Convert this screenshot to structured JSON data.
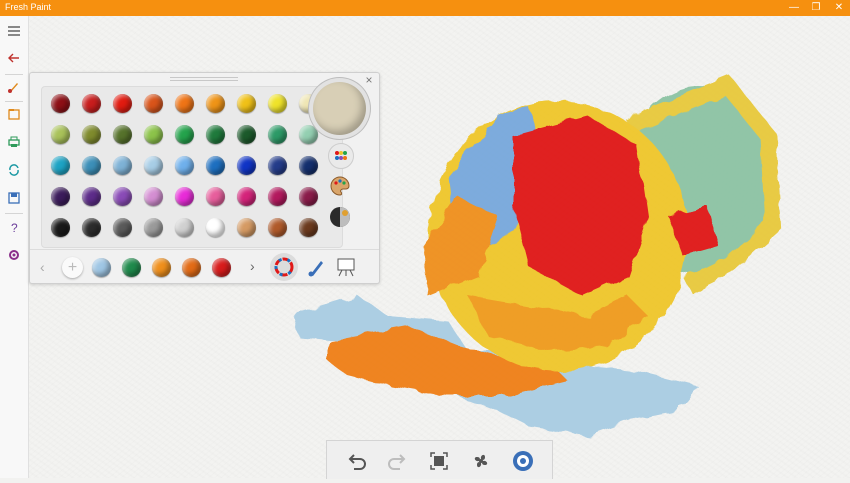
{
  "window": {
    "title": "Fresh Paint",
    "controls": [
      "—",
      "❐",
      "✕"
    ]
  },
  "sidebar": {
    "items": [
      "menu-icon",
      "back-icon",
      "brush-icon",
      "open-icon",
      "print-icon",
      "share-icon",
      "save-icon",
      "help-icon",
      "settings-icon"
    ]
  },
  "palette": {
    "rows": [
      [
        "#8e1016",
        "#c81d1d",
        "#e11b10",
        "#d9541a",
        "#ef7416",
        "#ef9417",
        "#f0c117",
        "#efe32a",
        "#efe6b4"
      ],
      [
        "#a9c25a",
        "#7f8b2d",
        "#56722b",
        "#8cc34a",
        "#24a34c",
        "#1f7a3c",
        "#1c5a2b",
        "#2c9a67",
        "#93cfb1"
      ],
      [
        "#1da3c4",
        "#3c8fb8",
        "#7eb2d6",
        "#a7cde6",
        "#6fb0ec",
        "#1d6fc0",
        "#1034c6",
        "#243c8a",
        "#142f6e"
      ],
      [
        "#3c1c5c",
        "#5d2c8a",
        "#8a4bb7",
        "#d48ed2",
        "#e82bd8",
        "#e75e9c",
        "#d4237a",
        "#b3195e",
        "#8a1c4a"
      ],
      [
        "#1a1a1a",
        "#2c2c2c",
        "#5a5a5a",
        "#9a9a9a",
        "#d0d0d0",
        "#ffffff",
        "#d59a63",
        "#b05a2a",
        "#6b3a1e"
      ]
    ],
    "mix_color": "#d8cfb6",
    "recent": [
      "#ffffff",
      "#9fc6e4",
      "#1f8a4c",
      "#ef8f1c",
      "#e26b16",
      "#d81c1c"
    ]
  },
  "toolbar": {
    "items": [
      "undo-icon",
      "redo-icon",
      "fit-icon",
      "fan-icon",
      "brush-settings-icon"
    ]
  }
}
